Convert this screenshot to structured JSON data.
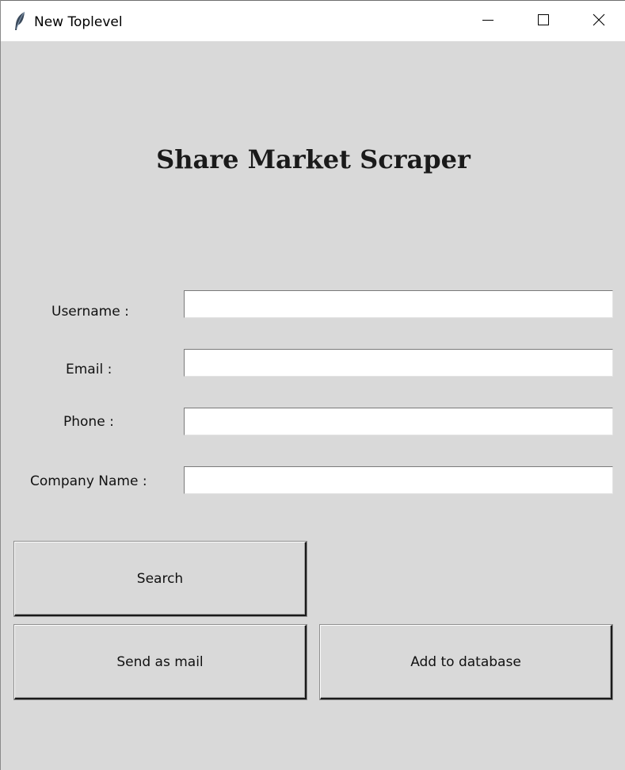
{
  "window": {
    "title": "New Toplevel",
    "controls": {
      "minimize": "minimize",
      "maximize": "maximize",
      "close": "close"
    }
  },
  "app": {
    "heading": "Share Market Scraper"
  },
  "form": {
    "username": {
      "label": "Username :",
      "value": ""
    },
    "email": {
      "label": "Email :",
      "value": ""
    },
    "phone": {
      "label": "Phone :",
      "value": ""
    },
    "company": {
      "label": "Company Name :",
      "value": ""
    }
  },
  "buttons": {
    "search": "Search",
    "send_mail": "Send as mail",
    "add_db": "Add to database"
  },
  "icons": {
    "app_icon": "feather-icon",
    "minimize": "minimize-icon",
    "maximize": "maximize-icon",
    "close": "close-icon"
  },
  "colors": {
    "window_bg": "#d9d9d9",
    "titlebar_bg": "#ffffff",
    "entry_bg": "#ffffff",
    "text": "#111111"
  }
}
